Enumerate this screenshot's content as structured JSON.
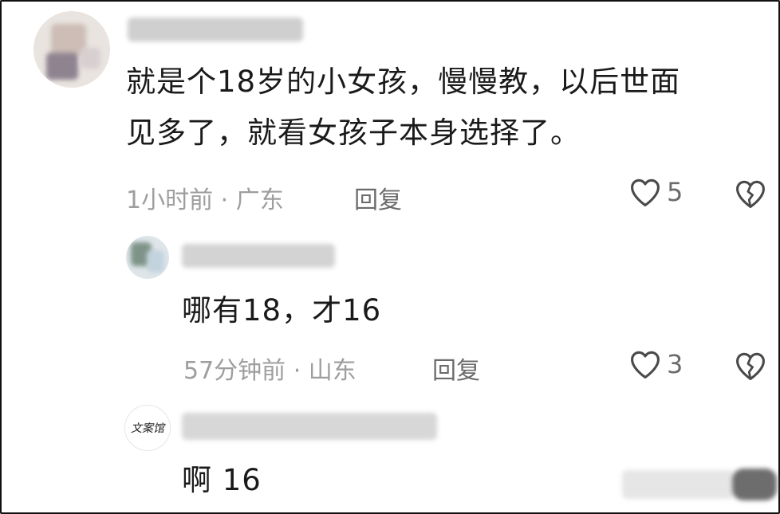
{
  "comments": [
    {
      "text_lines": [
        "就是个18岁的小女孩，慢慢教，以后世面",
        "见多了，就看女孩子本身选择了。"
      ],
      "meta": "1小时前 · 广东",
      "reply_label": "回复",
      "likes": "5"
    },
    {
      "text": "哪有18，才16",
      "meta": "57分钟前 · 山东",
      "reply_label": "回复",
      "likes": "3"
    },
    {
      "avatar_text": "文案馆",
      "text": "啊 16"
    }
  ],
  "icons": {
    "like": "heart-outline-icon",
    "dislike": "broken-heart-icon"
  }
}
